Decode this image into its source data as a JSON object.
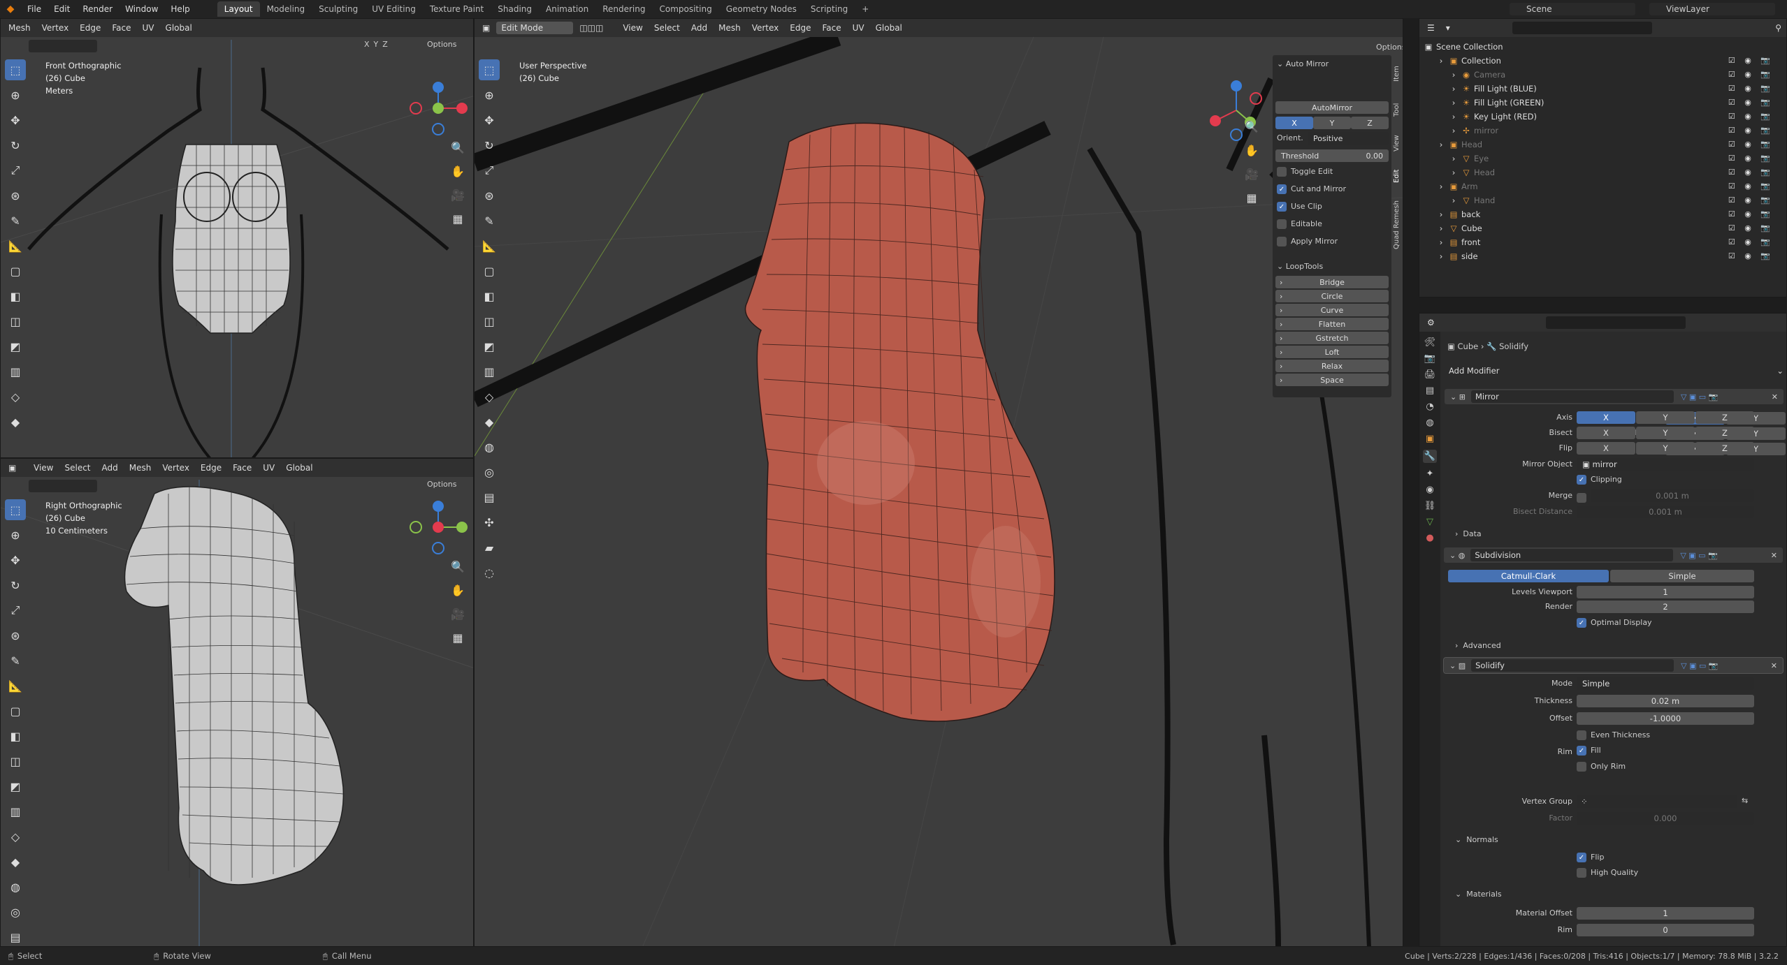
{
  "menubar": {
    "items": [
      "File",
      "Edit",
      "Render",
      "Window",
      "Help"
    ],
    "workspaces": [
      "Layout",
      "Modeling",
      "Sculpting",
      "UV Editing",
      "Texture Paint",
      "Shading",
      "Animation",
      "Rendering",
      "Compositing",
      "Geometry Nodes",
      "Scripting",
      "+"
    ],
    "active_workspace": "Layout",
    "scene": "Scene",
    "view_layer": "ViewLayer"
  },
  "left_header": {
    "items": [
      "Mesh",
      "Vertex",
      "Edge",
      "Face",
      "UV"
    ],
    "orientation": "Global",
    "options": "Options",
    "xyz": [
      "X",
      "Y",
      "Z"
    ]
  },
  "vp_front": {
    "line1": "Front Orthographic",
    "line2": "(26) Cube",
    "line3": "Meters"
  },
  "vp_right": {
    "header_items": [
      "View",
      "Select",
      "Add",
      "Mesh",
      "Vertex",
      "Edge",
      "Face",
      "UV"
    ],
    "orientation": "Global",
    "options": "Options",
    "line1": "Right Orthographic",
    "line2": "(26) Cube",
    "line3": "10 Centimeters"
  },
  "vp_main": {
    "mode": "Edit Mode",
    "header_items": [
      "View",
      "Select",
      "Add",
      "Mesh",
      "Vertex",
      "Edge",
      "Face",
      "UV"
    ],
    "orientation": "Global",
    "options": "Options",
    "line1": "User Perspective",
    "line2": "(26) Cube"
  },
  "npanel": {
    "auto_mirror_title": "Auto Mirror",
    "automirror_button": "AutoMirror",
    "axes": [
      "X",
      "Y",
      "Z"
    ],
    "orient_label": "Orient.",
    "orient_value": "Positive",
    "threshold_label": "Threshold",
    "threshold_value": "0.00",
    "toggle_edit": "Toggle Edit",
    "cut_and_mirror": "Cut and Mirror",
    "use_clip": "Use Clip",
    "editable": "Editable",
    "apply_mirror": "Apply Mirror",
    "looptools_title": "LoopTools",
    "looptools": [
      "Bridge",
      "Circle",
      "Curve",
      "Flatten",
      "Gstretch",
      "Loft",
      "Relax",
      "Space"
    ],
    "tabs": [
      "Item",
      "Tool",
      "View",
      "Edit",
      "Quad Remesh"
    ]
  },
  "outliner": {
    "root": "Scene Collection",
    "rows": [
      {
        "name": "Collection",
        "indent": 1,
        "icon": "▣"
      },
      {
        "name": "Camera",
        "indent": 2,
        "icon": "◉",
        "dim": true
      },
      {
        "name": "Fill Light (BLUE)",
        "indent": 2,
        "icon": "☀"
      },
      {
        "name": "Fill Light (GREEN)",
        "indent": 2,
        "icon": "☀"
      },
      {
        "name": "Key Light (RED)",
        "indent": 2,
        "icon": "☀"
      },
      {
        "name": "mirror",
        "indent": 2,
        "icon": "✢",
        "dim": true
      },
      {
        "name": "Head",
        "indent": 1,
        "icon": "▣",
        "dim": true
      },
      {
        "name": "Eye",
        "indent": 2,
        "icon": "▽",
        "dim": true
      },
      {
        "name": "Head",
        "indent": 2,
        "icon": "▽",
        "dim": true
      },
      {
        "name": "Arm",
        "indent": 1,
        "icon": "▣",
        "dim": true
      },
      {
        "name": "Hand",
        "indent": 2,
        "icon": "▽",
        "dim": true
      },
      {
        "name": "back",
        "indent": 1,
        "icon": "▤"
      },
      {
        "name": "Cube",
        "indent": 1,
        "icon": "▽"
      },
      {
        "name": "front",
        "indent": 1,
        "icon": "▤"
      },
      {
        "name": "side",
        "indent": 1,
        "icon": "▤"
      }
    ]
  },
  "properties": {
    "breadcrumb_object": "Cube",
    "breadcrumb_modifier": "Solidify",
    "add_modifier": "Add Modifier",
    "mirror": {
      "name": "Mirror",
      "axis_label": "Axis",
      "bisect_label": "Bisect",
      "flip_label": "Flip",
      "xyz": [
        "X",
        "Y",
        "Z"
      ],
      "mirror_object_label": "Mirror Object",
      "mirror_object": "mirror",
      "clipping": "Clipping",
      "merge_label": "Merge",
      "merge_value": "0.001 m",
      "bisect_distance_label": "Bisect Distance",
      "bisect_distance_value": "0.001 m",
      "data": "Data"
    },
    "subdivision": {
      "name": "Subdivision",
      "catmull": "Catmull-Clark",
      "simple": "Simple",
      "levels_label": "Levels Viewport",
      "levels_value": "1",
      "render_label": "Render",
      "render_value": "2",
      "optimal": "Optimal Display",
      "advanced": "Advanced"
    },
    "solidify": {
      "name": "Solidify",
      "mode_label": "Mode",
      "mode_value": "Simple",
      "thickness_label": "Thickness",
      "thickness_value": "0.02 m",
      "offset_label": "Offset",
      "offset_value": "-1.0000",
      "even_thickness": "Even Thickness",
      "rim_label": "Rim",
      "fill": "Fill",
      "only_rim": "Only Rim",
      "vgroup_label": "Vertex Group",
      "factor_label": "Factor",
      "factor_value": "0.000",
      "normals": "Normals",
      "flip": "Flip",
      "high_quality": "High Quality",
      "materials": "Materials",
      "mat_offset_label": "Material Offset",
      "mat_offset_value": "1",
      "rim_mat_label": "Rim",
      "rim_mat_value": "0"
    }
  },
  "statusbar": {
    "select": "Select",
    "rotate": "Rotate View",
    "call_menu": "Call Menu",
    "stats": "Cube | Verts:2/228 | Edges:1/436 | Faces:0/208 | Tris:416 | Objects:1/7 | Memory: 78.8 MiB | 3.2.2"
  },
  "colors": {
    "accent": "#4772b3",
    "mesh": "#b85a4a",
    "gizmo_x": "#e33b4e",
    "gizmo_y": "#8bc34a",
    "gizmo_z": "#3a7ed8"
  }
}
